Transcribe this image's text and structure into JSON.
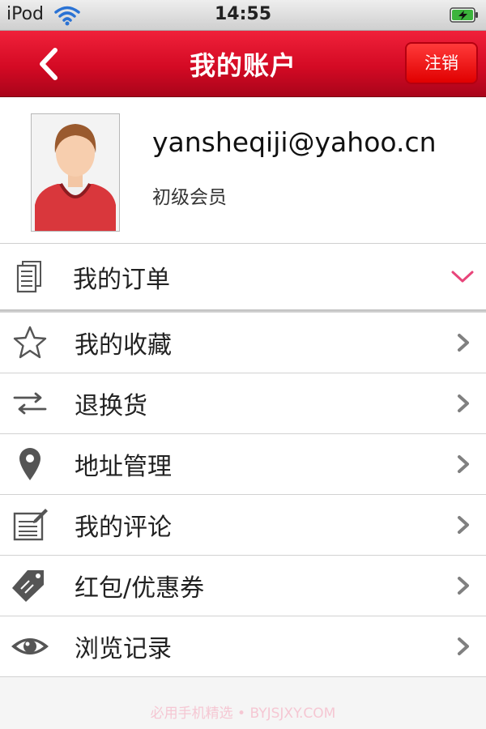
{
  "status_bar": {
    "carrier": "iPod",
    "time": "14:55",
    "icons": [
      "wifi-icon",
      "battery-charging-icon"
    ]
  },
  "nav": {
    "title": "我的账户",
    "back_icon": "chevron-left-icon",
    "logout_label": "注销"
  },
  "profile": {
    "email": "yansheqiji@yahoo.cn",
    "level": "初级会员",
    "avatar_icon": "user-avatar"
  },
  "orders": {
    "label": "我的订单",
    "icon": "document-list-icon",
    "chevron": "chevron-down-icon"
  },
  "menu": {
    "items": [
      {
        "label": "我的收藏",
        "icon": "star-icon"
      },
      {
        "label": "退换货",
        "icon": "exchange-arrows-icon"
      },
      {
        "label": "地址管理",
        "icon": "location-pin-icon"
      },
      {
        "label": "我的评论",
        "icon": "comment-edit-icon"
      },
      {
        "label": "红包/优惠券",
        "icon": "coupon-tag-icon"
      },
      {
        "label": "浏览记录",
        "icon": "eye-icon"
      }
    ]
  },
  "watermark": "必用手机精选 • BYJSJXY.COM",
  "colors": {
    "nav_red": "#d40a24",
    "logout_red": "#e00000",
    "chevron_pink": "#e8457a",
    "chevron_gray": "#808080"
  }
}
